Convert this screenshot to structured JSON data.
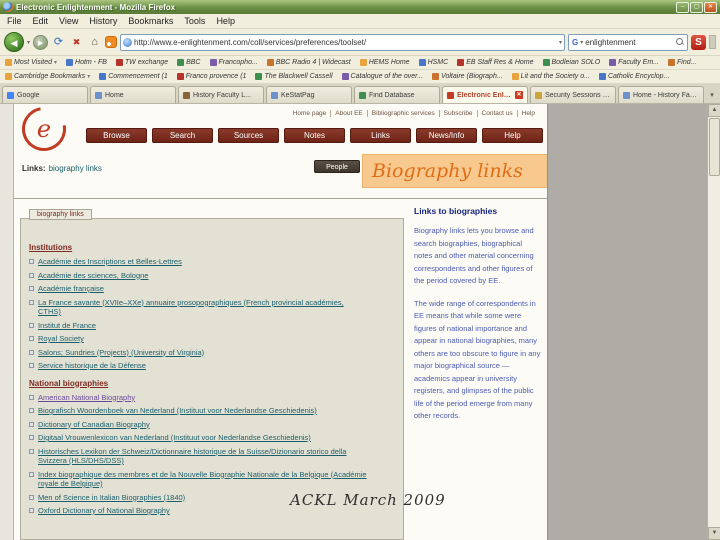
{
  "icons": {
    "back": "◀",
    "forward": "▶",
    "reload": "⟳",
    "stop": "✖",
    "home": "⌂",
    "dropdown": "▾",
    "close": "✕",
    "minimize": "–",
    "maximize": "▢",
    "scroll_up": "▲",
    "scroll_down": "▼",
    "tab_list": "▾",
    "google": "G",
    "s_badge": "S"
  },
  "window": {
    "title": "Electronic Enlightenment - Mozilla Firefox"
  },
  "menus": [
    "File",
    "Edit",
    "View",
    "History",
    "Bookmarks",
    "Tools",
    "Help"
  ],
  "browser": {
    "url": "http://www.e-enlightenment.com/coll/services/preferences/toolset/",
    "search_value": "enlightenment"
  },
  "bookmarks": {
    "row1": [
      {
        "label": "Most Visited"
      },
      {
        "label": "Hotm - FB"
      },
      {
        "label": "TW exchange"
      },
      {
        "label": "BBC"
      },
      {
        "label": "Francopho..."
      },
      {
        "label": "BBC Radio 4 | Widecast"
      },
      {
        "label": "HEMS Home"
      },
      {
        "label": "HSMC"
      },
      {
        "label": "EB Staff Res & Home"
      },
      {
        "label": "Bodleian SOLO"
      },
      {
        "label": "Faculty Em..."
      },
      {
        "label": "Find..."
      }
    ],
    "row2": [
      {
        "label": "Cambridge Bookmarks"
      },
      {
        "label": "Commencement (1"
      },
      {
        "label": "Franco provence (1"
      },
      {
        "label": "The Blackwell Cassell"
      },
      {
        "label": "Catalogue of the over..."
      },
      {
        "label": "Voltaire (Biograph..."
      },
      {
        "label": "Lit and the Society o..."
      },
      {
        "label": "Catholic Encyclop..."
      }
    ]
  },
  "tabs": [
    {
      "label": "Google"
    },
    {
      "label": "Home"
    },
    {
      "label": "History Faculty L..."
    },
    {
      "label": "KeStatPag"
    },
    {
      "label": "Find Database"
    },
    {
      "label": "Electronic Enlightenm...",
      "active": true
    },
    {
      "label": "Security Sessions Hel..."
    },
    {
      "label": "Home - History Facult..."
    }
  ],
  "site": {
    "utility": [
      "Home page",
      "About EE",
      "Bibliographic services",
      "Subscribe",
      "Contact us",
      "Help"
    ],
    "nav": [
      "Browse",
      "Search",
      "Sources",
      "Notes",
      "Links",
      "News/Info",
      "Help"
    ],
    "breadcrumb_label": "Links:",
    "breadcrumb_value": "biography links",
    "people_button": "People",
    "annotation": "Biography links",
    "panel_tab": "biography links",
    "sections": [
      {
        "heading": "Institutions",
        "links": [
          "Académie des Inscriptions et Belles-Lettres",
          "Académie des sciences, Bologne",
          "Académie française",
          "La France savante (XVIIe–XXe) annuaire prosopographiques (French provincial académies, CTHS)",
          "Institut de France",
          "Royal Society",
          "Salons; Sundries (Projects) (University of Virginia)",
          "Service historique de la Défense"
        ]
      },
      {
        "heading": "National biographies",
        "links": [
          "American National Biography",
          "Biografisch Woordenboek van Nederland (Instituut voor Nederlandse Geschiedenis)",
          "Dictionary of Canadian Biography",
          "Digitaal Vrouwenlexicon van Nederland (Instituut voor Nederlandse Geschiedenis)",
          "Historisches Lexikon der Schweiz/Dictionnaire historique de la Suisse/Dizionario storico della Svizzera (HLS/DHS/DSS)",
          "Index biographique des membres et de la Nouvelle Biographie Nationale de la Belgique (Académie royale de Belgique)",
          "Men of Science in Italian Biographies (1840)",
          "Oxford Dictionary of National Biography"
        ]
      }
    ],
    "sidebar": {
      "heading": "Links to biographies",
      "para1": "Biography links lets you browse and search biographies, biographical notes and other material concerning correspondents and other figures of the period covered by EE.",
      "para2": "The wide range of correspondents in EE means that while some were figures of national importance and appear in national biographies, many others are too obscure to figure in any major biographical source — academics appear in university registers, and glimpses of the public life of the period emerge from many other records."
    }
  },
  "caption": "ACKL March 2009"
}
